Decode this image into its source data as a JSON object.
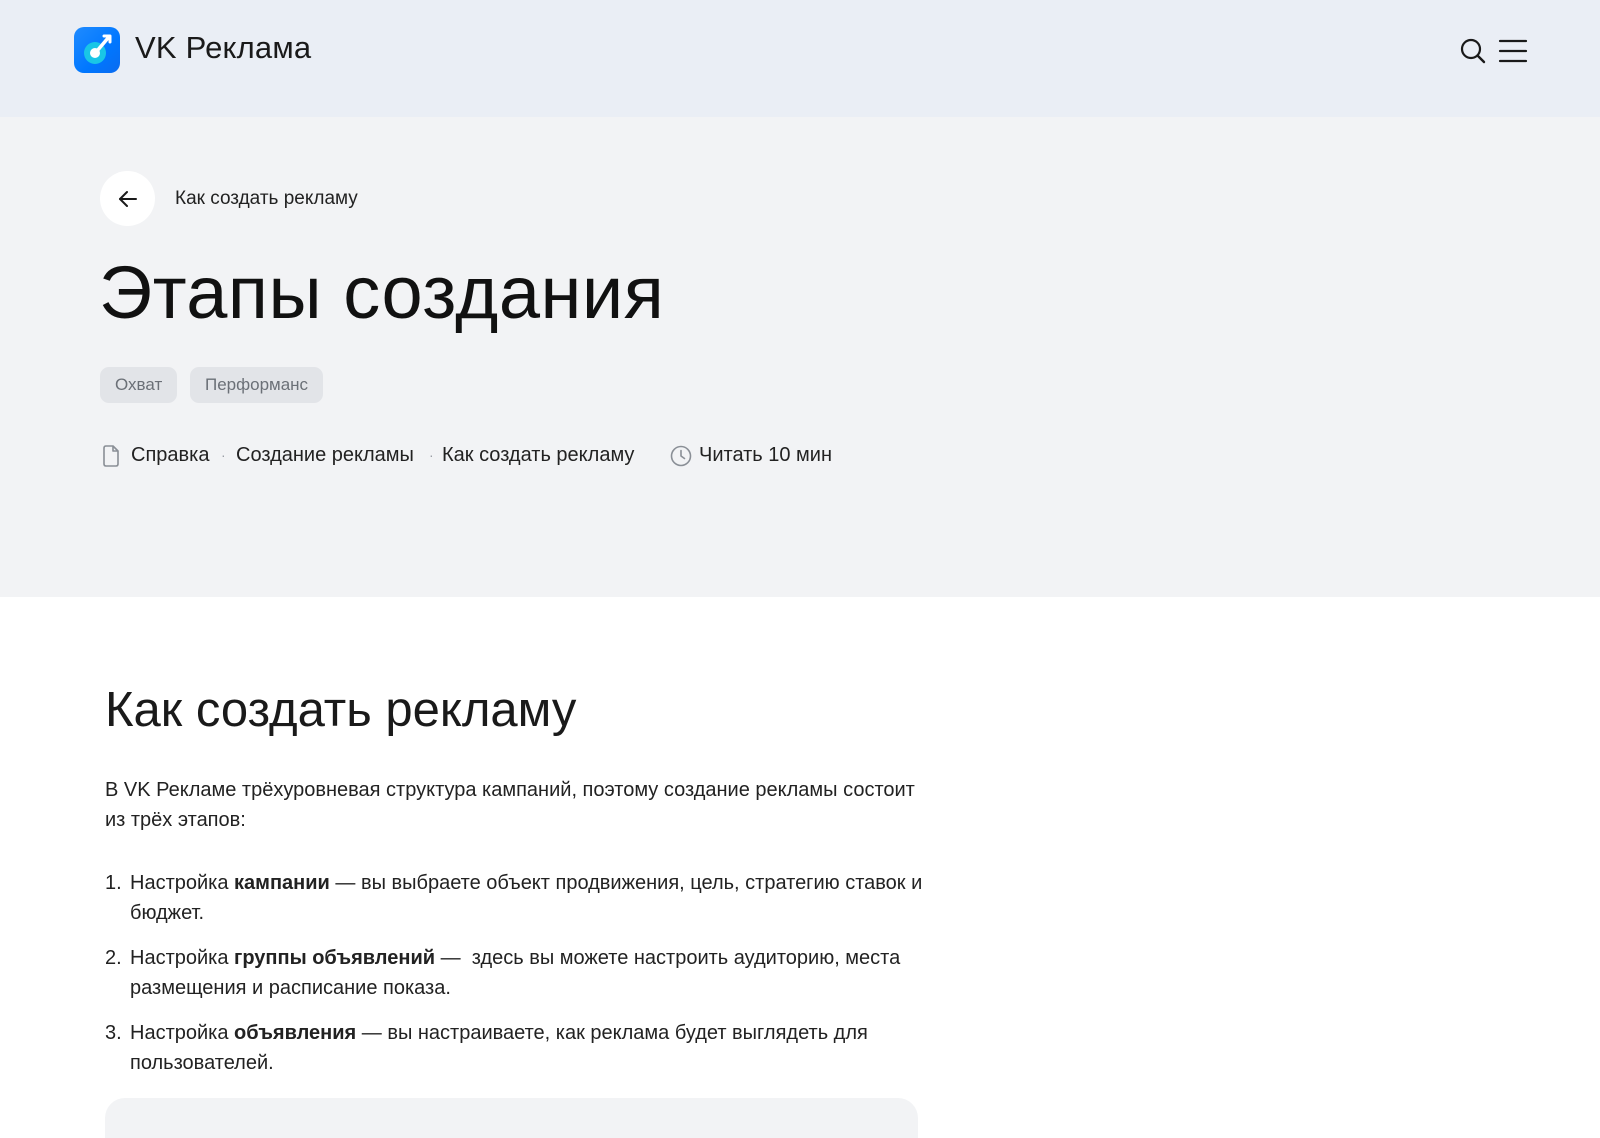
{
  "header": {
    "brand": "VK Реклама",
    "icons": {
      "search": "search-icon",
      "menu": "menu-icon"
    },
    "colors": {
      "header_bg": "#eaeef5",
      "logo_blue": "#0077ff"
    }
  },
  "hero": {
    "back_link": "Как создать рекламу",
    "title": "Этапы создания",
    "tags": [
      "Охват",
      "Перформанс"
    ],
    "breadcrumb": [
      "Справка",
      "Создание рекламы",
      "Как создать рекламу"
    ],
    "breadcrumb_separator": "·",
    "read_time": "Читать 10 мин"
  },
  "article": {
    "heading": "Как создать рекламу",
    "intro": "В VK Рекламе трёхуровневая структура кампаний, поэтому создание рекламы состоит из трёх этапов:",
    "steps": [
      {
        "num": "1.",
        "prefix": "Настройка ",
        "bold": "кампании",
        "rest": " — вы выбраете объект продвижения, цель, стратегию ставок и бюджет."
      },
      {
        "num": "2.",
        "prefix": "Настройка ",
        "bold": "группы объявлений",
        "rest": " —  здесь вы можете настроить аудиторию, места размещения и расписание показа."
      },
      {
        "num": "3.",
        "prefix": "Настройка ",
        "bold": "объявления",
        "rest": " — вы настраиваете, как реклама будет выглядеть для пользователей."
      }
    ]
  }
}
